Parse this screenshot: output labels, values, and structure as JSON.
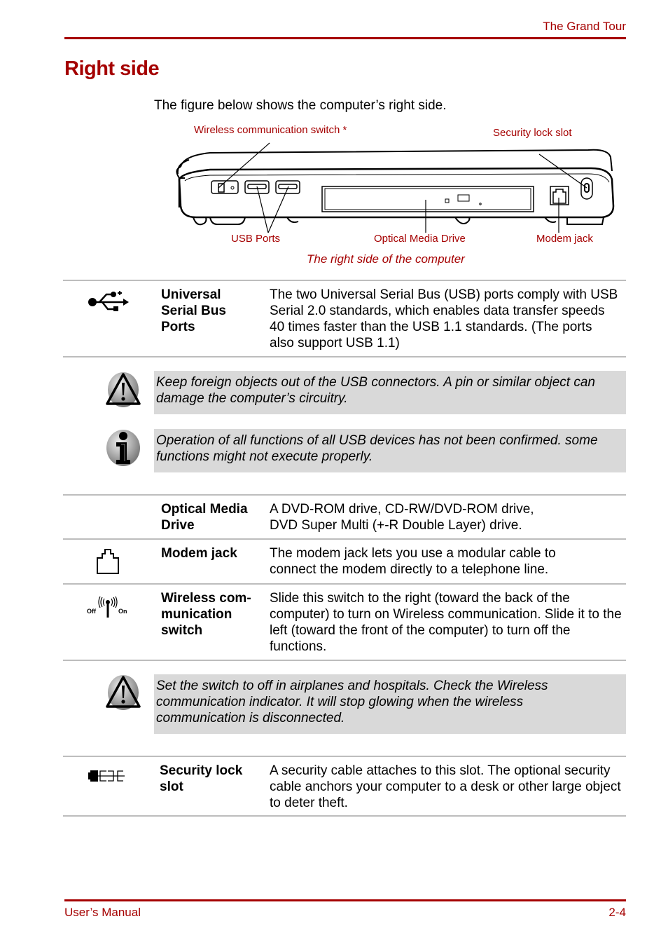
{
  "header": {
    "section": "The Grand Tour"
  },
  "page": {
    "title": "Right side",
    "intro": "The figure below shows the computer’s right side."
  },
  "figure": {
    "labels": {
      "wireless_switch": "Wireless communication switch *",
      "security_lock": "Security lock slot",
      "usb_ports": "USB Ports",
      "optical_drive": "Optical Media Drive",
      "modem_jack": "Modem jack"
    },
    "caption": "The right side of the computer"
  },
  "items": [
    {
      "icon": "usb-icon",
      "term": "Universal Serial Bus Ports",
      "desc": "The two Universal Serial Bus (USB) ports comply with USB Serial 2.0 standards, which enables data transfer speeds 40 times faster than the USB 1.1 standards. (The ports also support USB 1.1)"
    },
    {
      "icon": "",
      "term": "Optical Media Drive",
      "desc": "A DVD-ROM drive, CD-RW/DVD-ROM drive, DVD Super Multi (+-R Double Layer) drive."
    },
    {
      "icon": "modem-jack-icon",
      "term": "Modem jack",
      "desc": "The modem jack lets you use a modular cable to connect the modem directly to a telephone line."
    },
    {
      "icon": "wireless-switch-icon",
      "term": "Wireless com-munication switch",
      "desc": "Slide this switch to the right (toward the back of the computer) to turn on Wireless communication. Slide it to the left (toward the front of the computer) to turn off the functions.",
      "icon_labels": {
        "off": "Off",
        "on": "On"
      }
    },
    {
      "icon": "security-lock-icon",
      "term": "Security lock slot",
      "desc": "A security cable attaches to this slot. The optional security cable anchors your computer to a desk or other large object to deter theft."
    }
  ],
  "notes": [
    {
      "type": "warning",
      "text": "Keep foreign objects out of the USB connectors. A pin or similar object can damage the computer’s circuitry."
    },
    {
      "type": "info",
      "text": "Operation of all functions of all USB devices has not been confirmed. some functions might not execute properly."
    },
    {
      "type": "warning",
      "text": "Set the switch to off in airplanes and hospitals. Check the Wireless communication indicator. It will stop glowing when the wireless communication is disconnected."
    }
  ],
  "footer": {
    "left": "User’s Manual",
    "right": "2-4"
  },
  "colors": {
    "accent": "#a50000",
    "note_bg": "#d9d9d9",
    "rule": "#bdbdbd"
  }
}
